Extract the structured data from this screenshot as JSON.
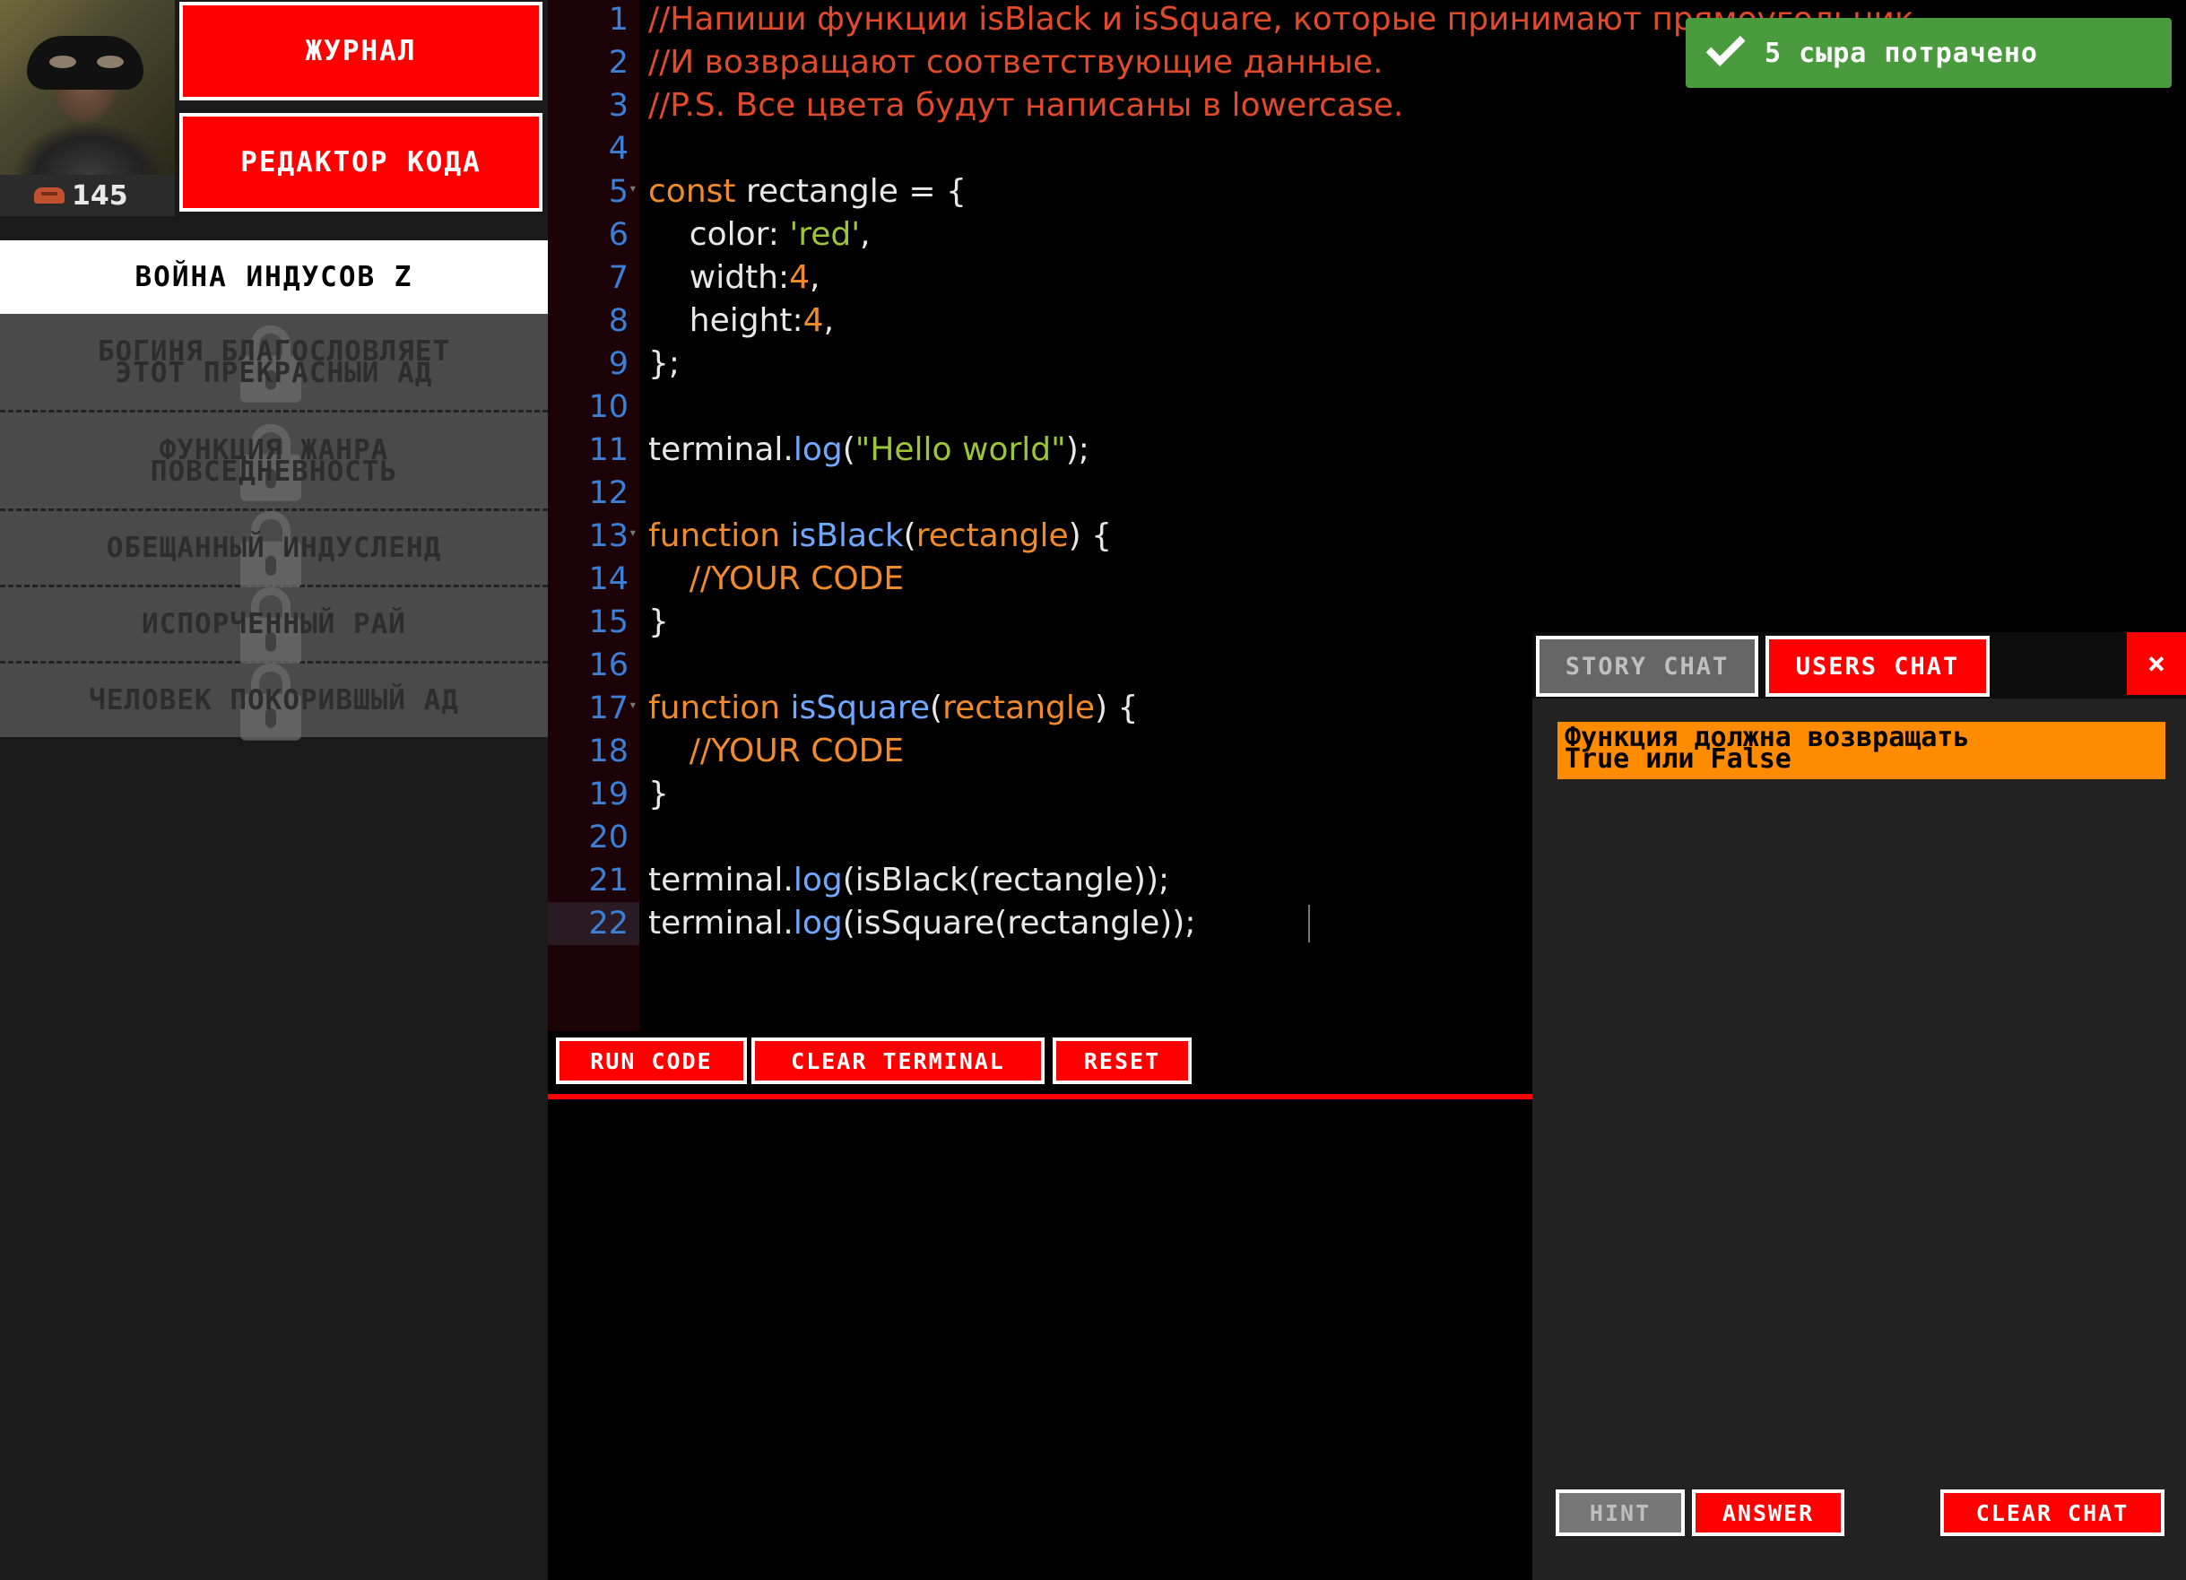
{
  "sidebar": {
    "coins": "145",
    "coin_icon": "cheese-coin-icon",
    "journal_label": "ЖУРНАЛ",
    "editor_label": "РЕДАКТОР КОДА",
    "active_chapter": "ВОЙНА ИНДУСОВ Z",
    "locked_chapters": [
      {
        "line1": "БОГИНЯ БЛАГОСЛОВЛЯЕТ",
        "line2": "ЭТОТ ПРЕКРАСНЫЙ АД"
      },
      {
        "line1": "ФУНКЦИЯ ЖАНРА",
        "line2": "ПОВСЕДНЕВНОСТЬ"
      },
      {
        "line1": "ОБЕЩАННЫЙ ИНДУСЛЕНД",
        "line2": ""
      },
      {
        "line1": "ИСПОРЧЕННЫЙ РАЙ",
        "line2": ""
      },
      {
        "line1": "ЧЕЛОВЕК ПОКОРИВШЫЙ АД",
        "line2": ""
      }
    ],
    "lock_icon": "lock-icon"
  },
  "editor": {
    "line_numbers": [
      "1",
      "2",
      "3",
      "4",
      "5",
      "6",
      "7",
      "8",
      "9",
      "10",
      "11",
      "12",
      "13",
      "14",
      "15",
      "16",
      "17",
      "18",
      "19",
      "20",
      "21",
      "22"
    ],
    "code": {
      "l1": "//Напиши функции isBlack и isSquare, которые принимают прямоугольник",
      "l2": "//И возвращают соответствующие данные.",
      "l3": "//P.S. Все цвета будут написаны в lowercase.",
      "l5_kw": "const",
      "l5_rest": " rectangle = {",
      "l6_key": "    color: ",
      "l6_val": "'red'",
      "l6_end": ",",
      "l7_key": "    width:",
      "l7_val": "4",
      "l7_end": ",",
      "l8_key": "    height:",
      "l8_val": "4",
      "l8_end": ",",
      "l9": "};",
      "l11_obj": "terminal.",
      "l11_fn": "log",
      "l11_open": "(",
      "l11_str": "\"Hello world\"",
      "l11_close": ");",
      "l13_kw": "function",
      "l13_name": " isBlack",
      "l13_open": "(",
      "l13_param": "rectangle",
      "l13_close": ") {",
      "l14": "    //YOUR CODE",
      "l15": "}",
      "l17_kw": "function",
      "l17_name": " isSquare",
      "l17_open": "(",
      "l17_param": "rectangle",
      "l17_close": ") {",
      "l18": "    //YOUR CODE",
      "l19": "}",
      "l21_obj": "terminal.",
      "l21_fn": "log",
      "l21_rest": "(isBlack(rectangle));",
      "l22_obj": "terminal.",
      "l22_fn": "log",
      "l22_rest": "(isSquare(rectangle));"
    },
    "run_label": "RUN CODE",
    "clear_terminal_label": "CLEAR TERMINAL",
    "reset_label": "RESET"
  },
  "toast": {
    "text": "5 сыра потрачено",
    "icon": "check-icon",
    "color": "#4a9a3e"
  },
  "chat": {
    "story_tab": "STORY CHAT",
    "users_tab": "USERS CHAT",
    "close": "×",
    "message": "Функция должна возвращать\nTrue или False",
    "hint_label": "HINT",
    "answer_label": "ANSWER",
    "clear_chat_label": "CLEAR CHAT"
  },
  "colors": {
    "accent": "#ff0000",
    "message": "#ff8c00",
    "comment": "#e14a2a",
    "keyword": "#f08a2b",
    "string": "#9dc53a",
    "function": "#70a8ff"
  }
}
